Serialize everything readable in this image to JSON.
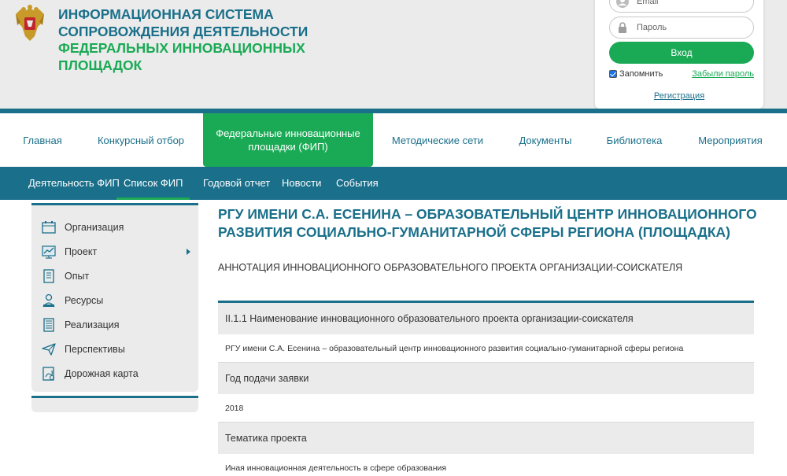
{
  "header": {
    "title_line1": "Информационная система",
    "title_line2": "сопровождения деятельности",
    "title_line3": "федеральных инновационных",
    "title_line4": "площадок"
  },
  "login": {
    "email_placeholder": "Email",
    "password_placeholder": "Пароль",
    "submit_label": "Вход",
    "remember_label": "Запомнить",
    "remember_checked": true,
    "forgot_label": "Забыли пароль",
    "register_label": "Регистрация"
  },
  "main_nav": {
    "items": [
      {
        "label": "Главная"
      },
      {
        "label": "Конкурсный отбор"
      },
      {
        "label": "Федеральные инновационные площадки (ФИП)"
      },
      {
        "label": "Методические сети"
      },
      {
        "label": "Документы"
      },
      {
        "label": "Библиотека"
      },
      {
        "label": "Мероприятия"
      }
    ]
  },
  "sub_nav": {
    "items": [
      {
        "label": "Деятельность ФИП"
      },
      {
        "label": "Список ФИП"
      },
      {
        "label": "Годовой отчет"
      },
      {
        "label": "Новости"
      },
      {
        "label": "События"
      }
    ]
  },
  "sidebar": {
    "items": [
      {
        "label": "Организация",
        "icon": "building-icon"
      },
      {
        "label": "Проект",
        "icon": "chart-icon"
      },
      {
        "label": "Опыт",
        "icon": "document-icon"
      },
      {
        "label": "Ресурсы",
        "icon": "person-icon"
      },
      {
        "label": "Реализация",
        "icon": "list-icon"
      },
      {
        "label": "Перспективы",
        "icon": "paper-plane-icon"
      },
      {
        "label": "Дорожная карта",
        "icon": "map-icon"
      }
    ]
  },
  "main": {
    "title": "РГУ имени С.А. Есенина – образовательный центр инновационного развития социально-гуманитарной сферы региона (площадка)",
    "annotation": "АННОТАЦИЯ ИННОВАЦИОННОГО ОБРАЗОВАТЕЛЬНОГО ПРОЕКТА ОРГАНИЗАЦИИ-СОИСКАТЕЛЯ",
    "rows": [
      {
        "header": "II.1.1 Наименование инновационного образовательного проекта организации-соискателя",
        "value": "РГУ имени С.А. Есенина – образовательный центр инновационного развития социально-гуманитарной сферы региона"
      },
      {
        "header": "Год подачи заявки",
        "value": "2018"
      },
      {
        "header": "Тематика проекта",
        "value": "Иная инновационная деятельность в сфере образования"
      }
    ]
  },
  "colors": {
    "teal": "#1a6f8a",
    "green": "#1aaa55",
    "gray_bg": "#ebebeb"
  }
}
